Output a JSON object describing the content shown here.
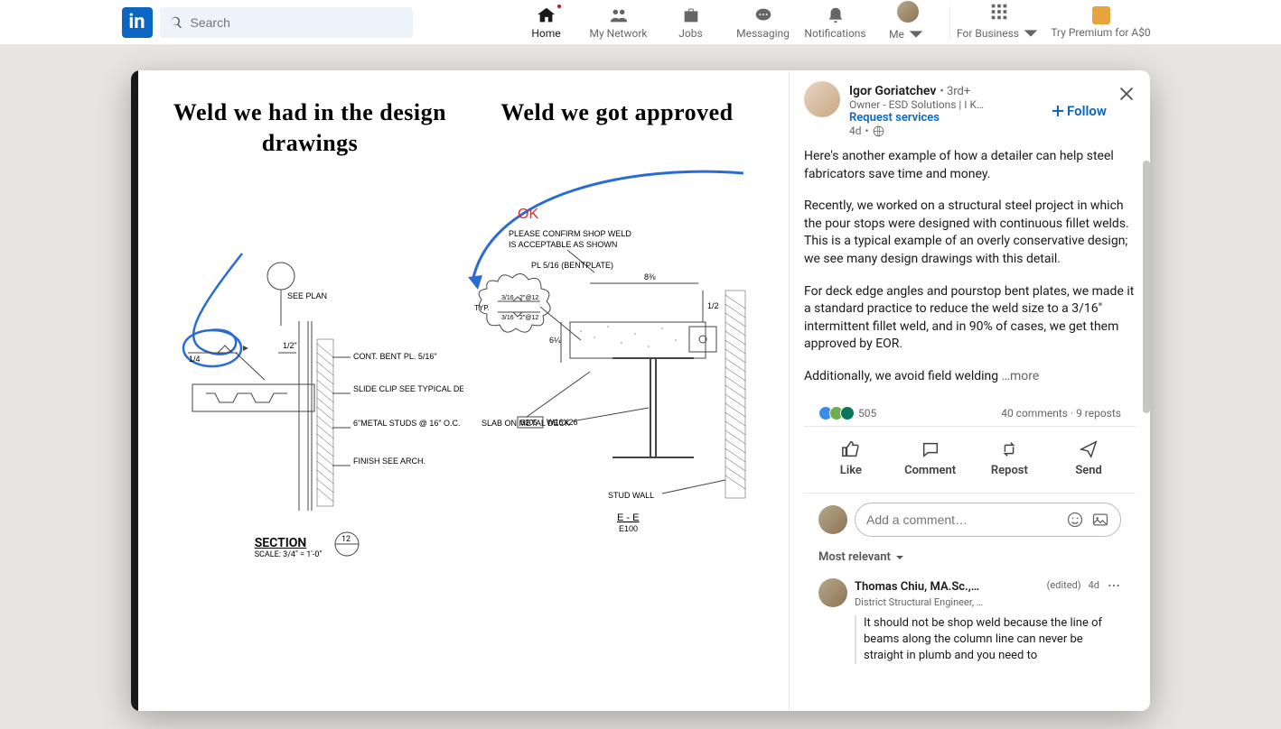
{
  "nav": {
    "logo": "in",
    "search_placeholder": "Search",
    "items": [
      {
        "label": "Home",
        "key": "home"
      },
      {
        "label": "My Network",
        "key": "network"
      },
      {
        "label": "Jobs",
        "key": "jobs"
      },
      {
        "label": "Messaging",
        "key": "messaging"
      },
      {
        "label": "Notifications",
        "key": "notifications"
      },
      {
        "label": "Me",
        "key": "me"
      }
    ],
    "business_label": "For Business",
    "premium_label": "Try Premium for A$0"
  },
  "post": {
    "author": {
      "name": "Igor Goriatchev",
      "degree": "• 3rd+",
      "headline": "Owner - ESD Solutions | I K…",
      "request": "Request services",
      "time": "4d",
      "sep": "•"
    },
    "follow_label": "Follow",
    "body": {
      "p1": "Here's another example of how a detailer can help steel fabricators save time and money.",
      "p2": "Recently, we worked on a structural steel project in which the pour stops were designed with continuous fillet welds. This is a typical example of an overly conservative design; we see many design drawings with this detail.",
      "p3": "For deck edge angles and pourstop bent plates, we made it a standard practice to reduce the weld size to a 3/16\" intermittent fillet weld, and in 90% of cases, we get them approved by EOR.",
      "p4": "Additionally, we avoid field welding  ",
      "more": "…more"
    },
    "reactions": "505",
    "comments_label": "40 comments",
    "reposts_label": "9 reposts",
    "sep": "·",
    "actions": {
      "like": "Like",
      "comment": "Comment",
      "repost": "Repost",
      "send": "Send"
    },
    "comment_placeholder": "Add a comment…",
    "sort_label": "Most relevant",
    "top_comment": {
      "name": "Thomas Chiu, MA.Sc.,…",
      "edited": "(edited)",
      "time": "4d",
      "title": "District Structural Engineer, …",
      "text": "It should not be shop weld because the line of beams along the column line can never be straight in plumb and you need to"
    }
  },
  "image": {
    "left_title": "Weld we had in the design drawings",
    "right_title": "Weld we got approved",
    "ok": "OK",
    "confirm1": "PLEASE CONFIRM SHOP WELD",
    "confirm2": "IS ACCEPTABLE AS SHOWN",
    "left_callouts": {
      "see_plan": "SEE\nPLAN",
      "cont": "CONT. BENT PL. 5/16\"",
      "slide": "SLIDE CLIP SEE\nTYPICAL DETAIL",
      "studs": "6\"METAL\nSTUDS @ 16\" O.C.",
      "finish": "FINISH\nSEE ARCH.",
      "quarter": "1/4",
      "half": "1/2\""
    },
    "right_callouts": {
      "pl": "PL 5/16 (BENTPLATE)",
      "typ": "TYP.",
      "w1": "3/16",
      "w2": "3/16",
      "w3": "2\"@12",
      "w4": "2\"@12",
      "d83": "8⅜",
      "d12": "1/2",
      "d614": "6¼",
      "slab": "SLAB ON METAL DECK",
      "b205": "B205",
      "w16": "W16X26",
      "stud": "STUD WALL",
      "ee": "E - E",
      "e100": "E100"
    },
    "section": "SECTION",
    "scale": "SCALE: 3/4\" = 1'-0\"",
    "s12": "12"
  }
}
